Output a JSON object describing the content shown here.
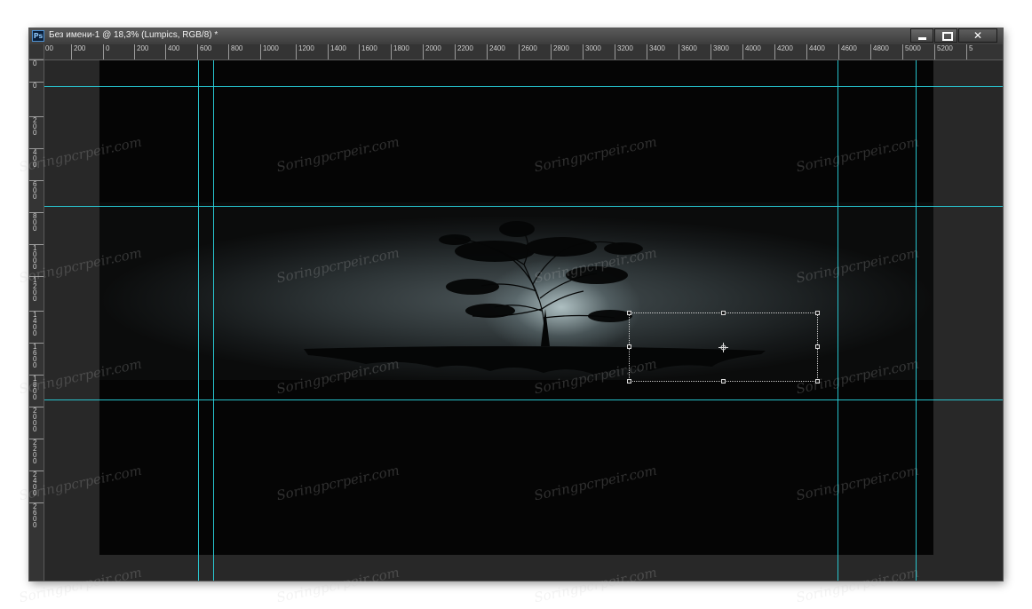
{
  "app": {
    "logo_text": "Ps",
    "document_title": "Без имени-1 @ 18,3% (Lumpics, RGB/8) *"
  },
  "window_controls": {
    "close_symbol": "✕"
  },
  "ruler_h": [
    "00",
    "200",
    "0",
    "200",
    "400",
    "600",
    "800",
    "1000",
    "1200",
    "1400",
    "1600",
    "1800",
    "2000",
    "2200",
    "2400",
    "2600",
    "2800",
    "3000",
    "3200",
    "3400",
    "3600",
    "3800",
    "4000",
    "4200",
    "4400",
    "4600",
    "4800",
    "5000",
    "5200",
    "5"
  ],
  "ruler_v": [
    "0",
    "0",
    "200",
    "400",
    "600",
    "800",
    "1000",
    "1200",
    "1400",
    "1600",
    "1800",
    "2000",
    "2200",
    "2400",
    "2600"
  ],
  "watermark_text": "Soringpcrpeir.com",
  "colors": {
    "guide": "#29d5e0",
    "canvas_bg": "#050505",
    "workspace_bg": "#282828"
  }
}
